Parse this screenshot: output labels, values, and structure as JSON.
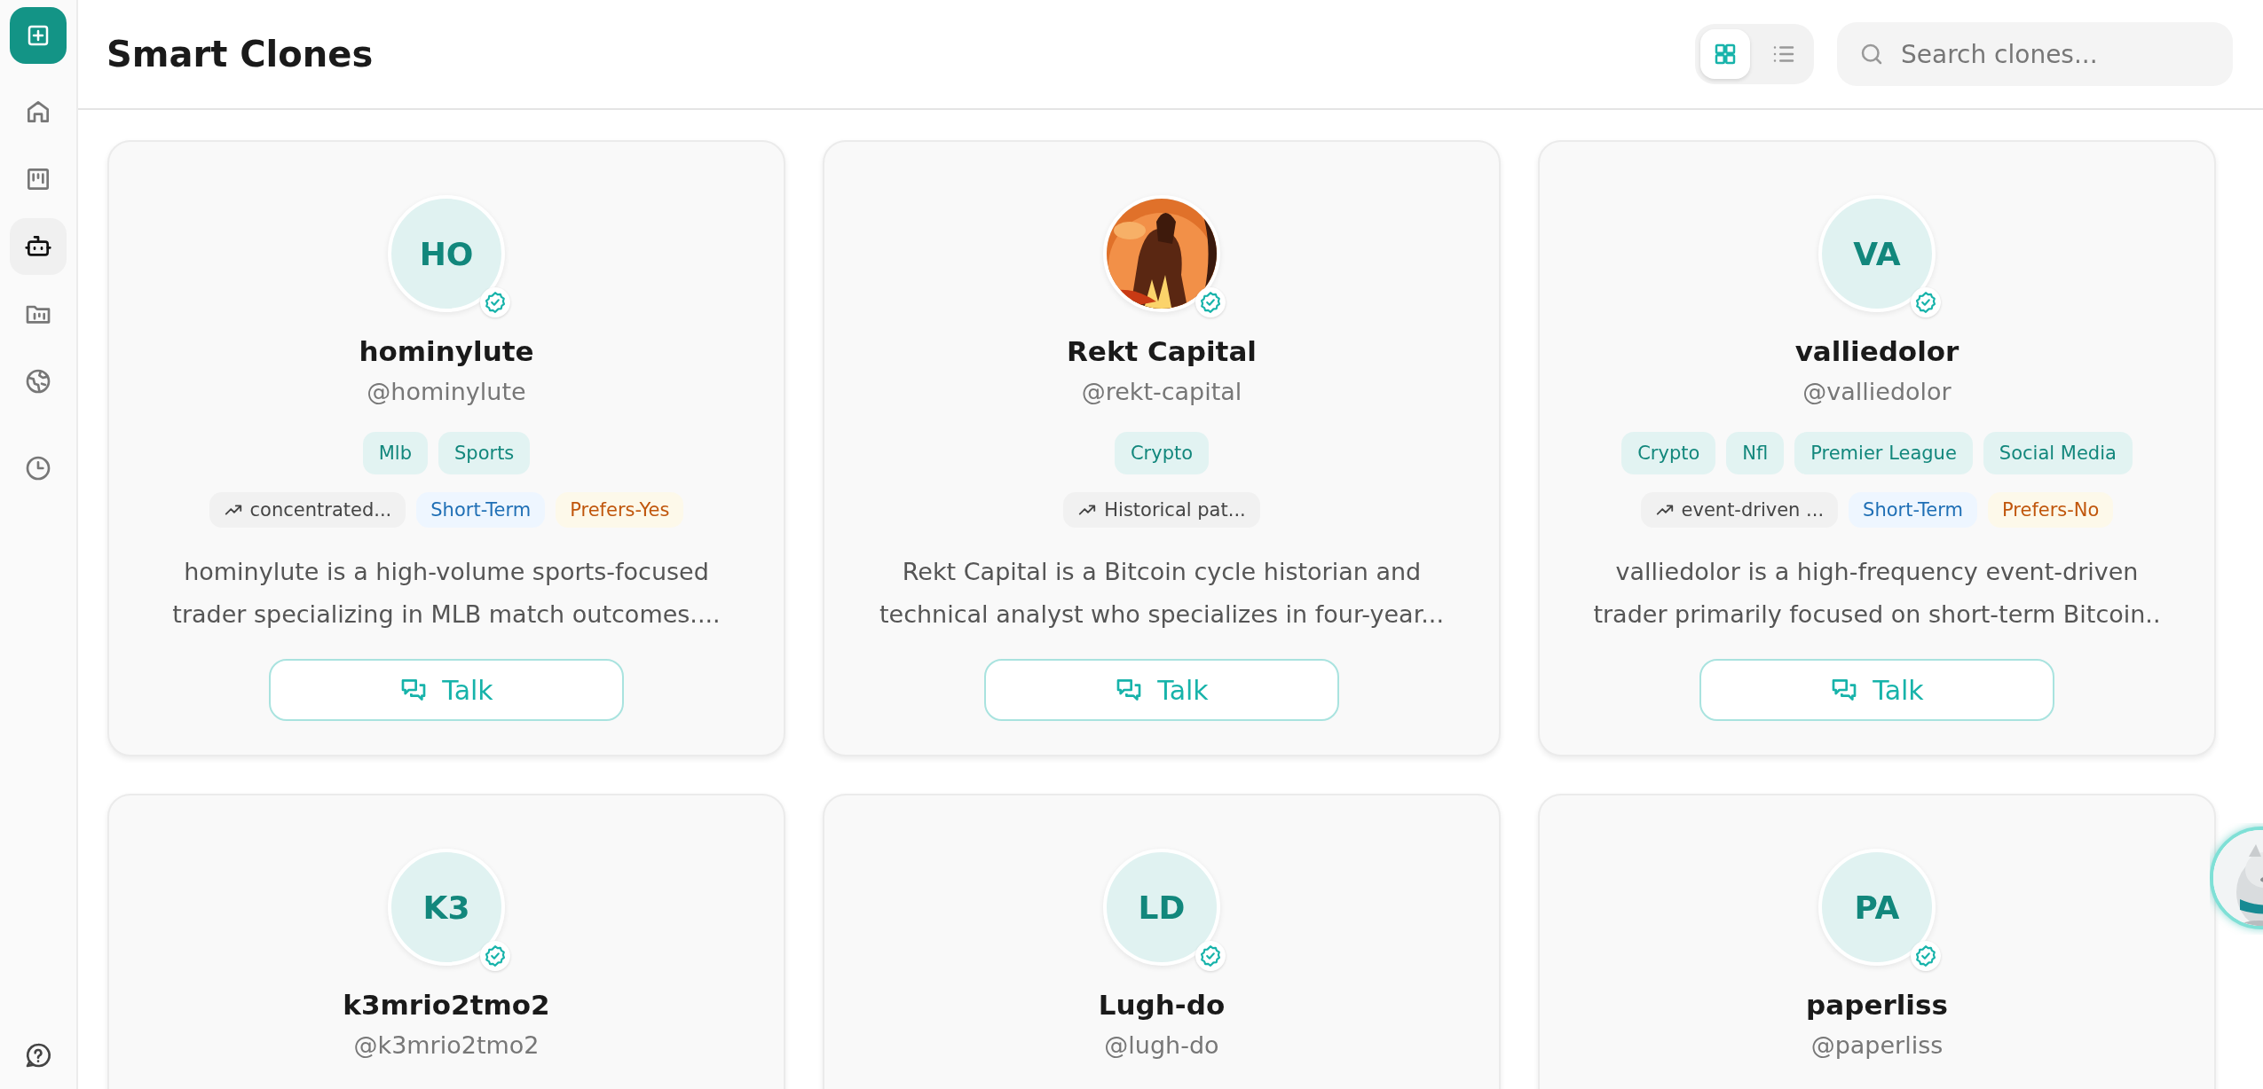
{
  "sidebar": {
    "items": [
      {
        "selected": false
      },
      {
        "selected": false
      },
      {
        "selected": true
      },
      {
        "selected": false
      },
      {
        "selected": false
      },
      {
        "selected": false
      }
    ]
  },
  "header": {
    "title": "Smart Clones",
    "view_toggle": [
      {
        "selected": true
      },
      {
        "selected": false
      }
    ],
    "search": {
      "placeholder": "Search clones..."
    }
  },
  "cards": [
    {
      "avatar": {
        "kind": "initials",
        "text": "HO"
      },
      "verified": true,
      "name": "hominylute",
      "handle": "@hominylute",
      "tags": [
        "Mlb",
        "Sports"
      ],
      "traits": [
        {
          "kind": "strategy",
          "text": "concentrated..."
        },
        {
          "kind": "horizon",
          "text": "Short-Term"
        },
        {
          "kind": "preference",
          "text": "Prefers-Yes"
        }
      ],
      "description": "hominylute is a high-volume sports-focused trader specializing in MLB match outcomes....",
      "button": "Talk"
    },
    {
      "avatar": {
        "kind": "picture"
      },
      "verified": true,
      "name": "Rekt Capital",
      "handle": "@rekt-capital",
      "tags": [
        "Crypto"
      ],
      "traits": [
        {
          "kind": "strategy",
          "text": "Historical pat..."
        }
      ],
      "description": "Rekt Capital is a Bitcoin cycle historian and technical analyst who specializes in four-year...",
      "button": "Talk"
    },
    {
      "avatar": {
        "kind": "initials",
        "text": "VA"
      },
      "verified": true,
      "name": "valliedolor",
      "handle": "@valliedolor",
      "tags": [
        "Crypto",
        "Nfl",
        "Premier League",
        "Social Media"
      ],
      "traits": [
        {
          "kind": "strategy",
          "text": "event-driven ..."
        },
        {
          "kind": "horizon",
          "text": "Short-Term"
        },
        {
          "kind": "preference",
          "text": "Prefers-No"
        }
      ],
      "description": "valliedolor is a high-frequency event-driven trader primarily focused on short-term Bitcoin..",
      "button": "Talk"
    },
    {
      "avatar": {
        "kind": "initials",
        "text": "K3"
      },
      "verified": true,
      "name": "k3mrio2tmo2",
      "handle": "@k3mrio2tmo2"
    },
    {
      "avatar": {
        "kind": "initials",
        "text": "LD"
      },
      "verified": true,
      "name": "Lugh-do",
      "handle": "@lugh-do"
    },
    {
      "avatar": {
        "kind": "initials",
        "text": "PA"
      },
      "verified": true,
      "name": "paperliss",
      "handle": "@paperliss"
    }
  ],
  "assistant": {
    "kind": "picture"
  }
}
